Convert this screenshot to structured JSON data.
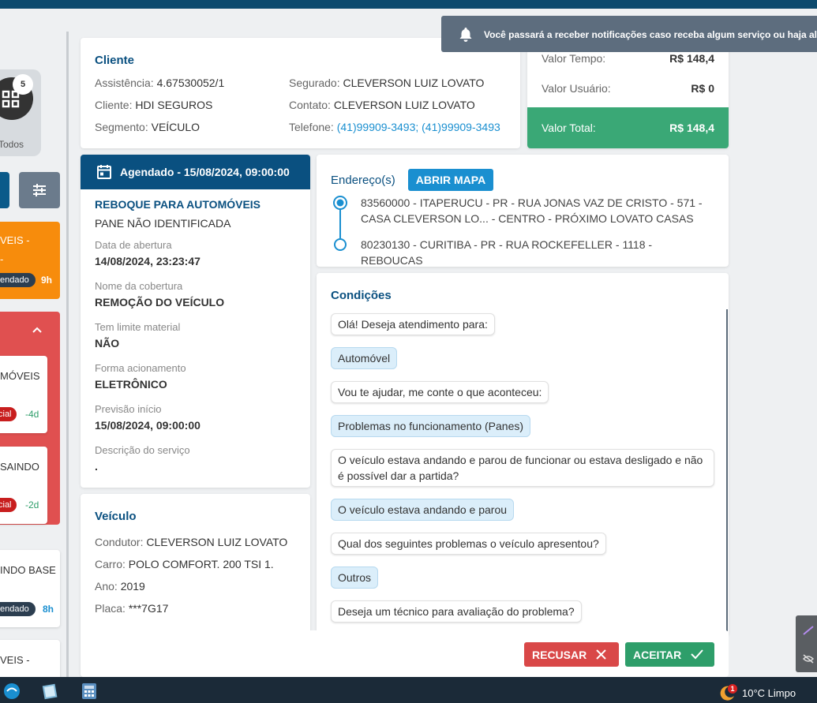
{
  "toast": {
    "text": "Você passará a receber notificações caso receba algum serviço ou haja al"
  },
  "rail": {
    "todos_badge": "5",
    "todos_label": "Todos",
    "cards": [
      {
        "title": "VEIS -",
        "title2": "-",
        "badge": "endado",
        "time": "9h"
      },
      {
        "title": "MÓVEIS",
        "badge": "cial",
        "time": "-4d"
      },
      {
        "title": "SAINDO",
        "badge": "cial",
        "time": "-2d"
      },
      {
        "title": "INDO BASE",
        "badge": "endado",
        "time": "8h"
      },
      {
        "title": "VEIS -"
      }
    ]
  },
  "cliente": {
    "title": "Cliente",
    "assistencia_label": "Assistência:",
    "assistencia": "4.67530052/1",
    "cliente_label": "Cliente:",
    "cliente": "HDI SEGUROS",
    "segmento_label": "Segmento:",
    "segmento": "VEÍCULO",
    "segurado_label": "Segurado:",
    "segurado": "CLEVERSON LUIZ LOVATO",
    "contato_label": "Contato:",
    "contato": "CLEVERSON LUIZ LOVATO",
    "telefone_label": "Telefone:",
    "telefone": "(41)99909-3493; (41)99909-3493"
  },
  "valores": {
    "tempo_label": "Valor Tempo:",
    "tempo": "R$ 148,4",
    "usuario_label": "Valor Usuário:",
    "usuario": "R$ 0",
    "total_label": "Valor Total:",
    "total": "R$ 148,4"
  },
  "agendamento": {
    "header": "Agendado - 15/08/2024, 09:00:00",
    "servico": "REBOQUE PARA AUTOMÓVEIS",
    "problema": "PANE NÃO IDENTIFICADA",
    "abertura_label": "Data de abertura",
    "abertura": "14/08/2024, 23:23:47",
    "cobertura_label": "Nome da cobertura",
    "cobertura": "REMOÇÃO DO VEÍCULO",
    "limite_label": "Tem limite material",
    "limite": "NÃO",
    "acionamento_label": "Forma acionamento",
    "acionamento": "ELETRÔNICO",
    "previsao_label": "Previsão início",
    "previsao": "15/08/2024, 09:00:00",
    "descricao_label": "Descrição do serviço",
    "descricao": "."
  },
  "enderecos": {
    "title": "Endereço(s)",
    "map_button": "ABRIR MAPA",
    "origem": "83560000 - ITAPERUCU - PR - RUA JONAS VAZ DE CRISTO - 571 - CASA CLEVERSON LO... - CENTRO - PRÓXIMO LOVATO CASAS",
    "destino": "80230130 - CURITIBA - PR - RUA ROCKEFELLER - 1118 - REBOUCAS"
  },
  "condicoes": {
    "title": "Condições",
    "messages": [
      {
        "type": "q",
        "text": "Olá! Deseja atendimento para:"
      },
      {
        "type": "a",
        "text": "Automóvel"
      },
      {
        "type": "q",
        "text": "Vou te ajudar, me conte o que aconteceu:"
      },
      {
        "type": "a",
        "text": "Problemas no funcionamento (Panes)"
      },
      {
        "type": "q",
        "text": "O veículo estava andando e parou de funcionar ou estava desligado e não é possível dar a partida?"
      },
      {
        "type": "a",
        "text": "O veículo estava andando e parou"
      },
      {
        "type": "q",
        "text": "Qual dos seguintes problemas o veículo apresentou?"
      },
      {
        "type": "a",
        "text": "Outros"
      },
      {
        "type": "q",
        "text": "Deseja um técnico para avaliação do problema?"
      }
    ]
  },
  "veiculo": {
    "title": "Veículo",
    "condutor_label": "Condutor:",
    "condutor": "CLEVERSON LUIZ LOVATO",
    "carro_label": "Carro:",
    "carro": "POLO COMFORT. 200 TSI 1.",
    "ano_label": "Ano:",
    "ano": "2019",
    "placa_label": "Placa:",
    "placa": "***7G17"
  },
  "actions": {
    "recusar": "RECUSAR",
    "aceitar": "ACEITAR"
  },
  "taskbar": {
    "weather_badge": "1",
    "weather": "10°C  Limpo"
  },
  "colors": {
    "primary": "#0a5080",
    "accent": "#1a8fd0",
    "success": "#3aa876",
    "danger": "#d94848",
    "warning": "#f78c0c"
  }
}
